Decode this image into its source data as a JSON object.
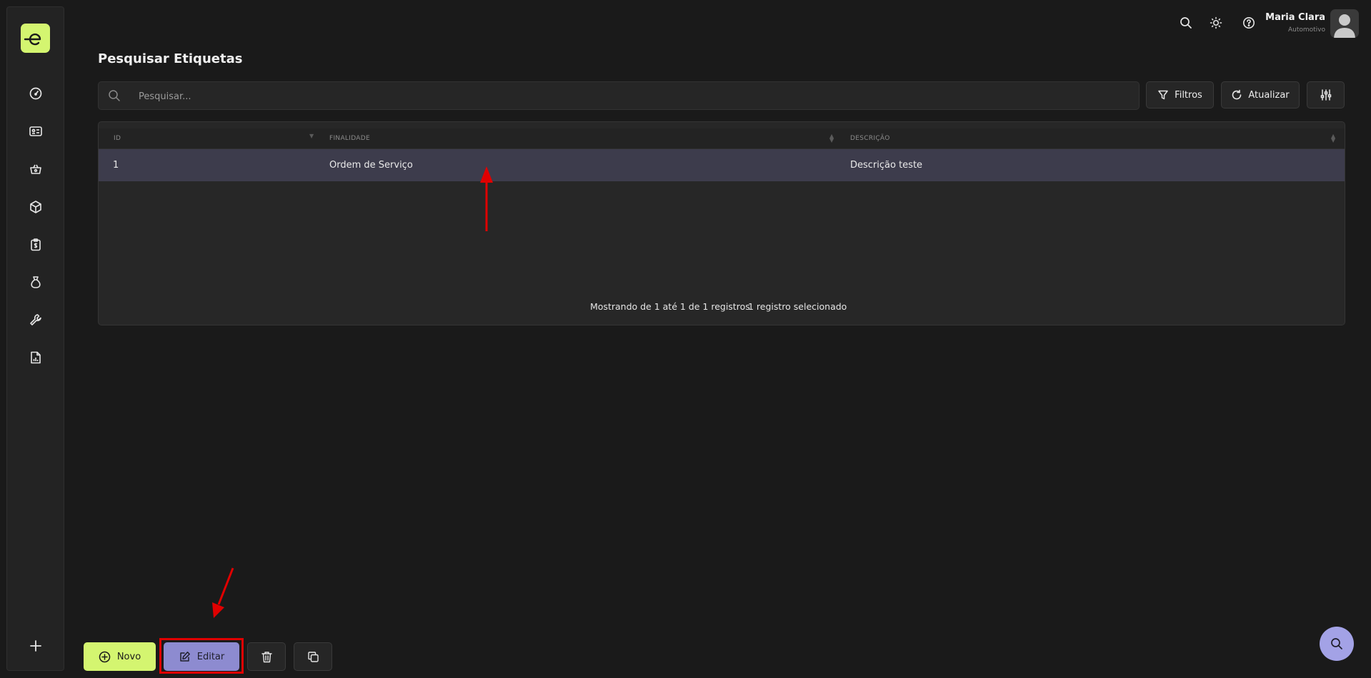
{
  "user": {
    "name": "Maria Clara",
    "role": "Automotivo"
  },
  "page": {
    "title": "Pesquisar Etiquetas"
  },
  "search": {
    "placeholder": "Pesquisar..."
  },
  "toolbar": {
    "filters_label": "Filtros",
    "refresh_label": "Atualizar"
  },
  "table": {
    "columns": [
      "ID",
      "FINALIDADE",
      "DESCRIÇÃO"
    ],
    "rows": [
      {
        "id": "1",
        "finalidade": "Ordem de Serviço",
        "descricao": "Descrição teste"
      }
    ],
    "footer": {
      "showing": "Mostrando de 1 até 1 de 1 registros",
      "selected": "1 registro selecionado"
    }
  },
  "actions": {
    "new_label": "Novo",
    "edit_label": "Editar"
  },
  "colors": {
    "accent": "#d4f570",
    "edit": "#8d8bd0",
    "selected_row": "#3d3c4c",
    "annotation": "#e00000"
  },
  "icons": {
    "sidebar": [
      "dashboard-icon",
      "id-card-icon",
      "basket-icon",
      "box-icon",
      "clipboard-dollar-icon",
      "money-bag-icon",
      "wrench-icon",
      "report-icon",
      "plus-icon"
    ],
    "top": [
      "search-icon",
      "sun-icon",
      "help-icon",
      "avatar-icon"
    ]
  }
}
